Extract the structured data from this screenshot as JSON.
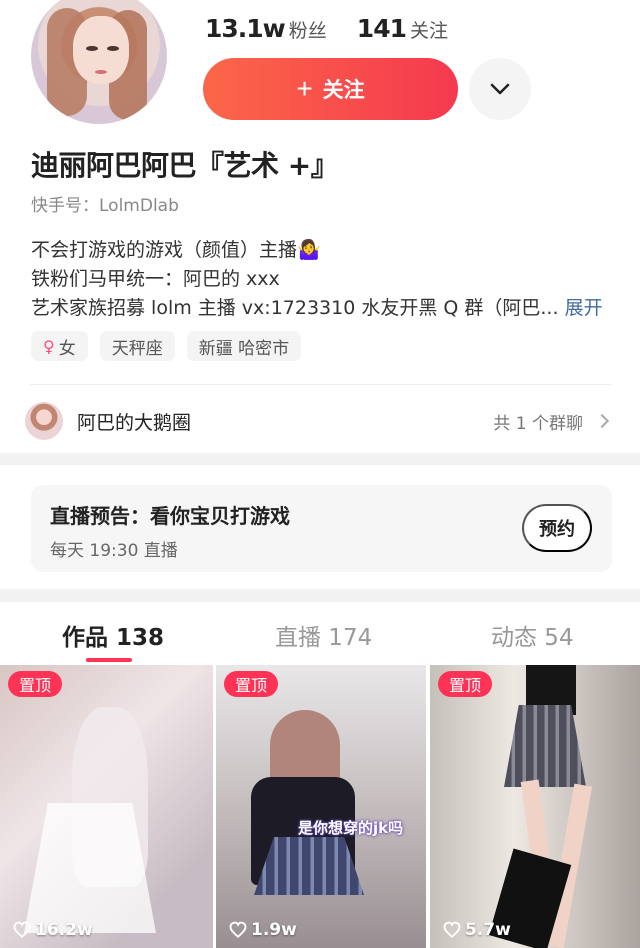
{
  "profile": {
    "followers": {
      "value": "13.1w",
      "label": "粉丝"
    },
    "following": {
      "value": "141",
      "label": "关注"
    },
    "follow_button": "关注",
    "follow_plus": "+",
    "name": "迪丽阿巴阿巴『艺术 +』",
    "kuaishou_id": "快手号：LolmDlab",
    "bio_lines": [
      "不会打游戏的游戏（颜值）主播🤷‍♀️",
      "铁粉们马甲统一：阿巴的 xxx",
      "艺术家族招募 lolm 主播 vx:1723310 水友开黑 Q 群（阿巴..."
    ],
    "expand_label": "展开",
    "tags": [
      {
        "icon": "♀",
        "label": "女"
      },
      {
        "label": "天秤座"
      },
      {
        "label": "新疆 哈密市"
      }
    ],
    "group": {
      "name": "阿巴的大鹅圈",
      "count": "共 1 个群聊"
    }
  },
  "live": {
    "title": "直播预告：看你宝贝打游戏",
    "time": "每天 19:30 直播",
    "button": "预约"
  },
  "tabs": [
    {
      "label": "作品 138",
      "active": true
    },
    {
      "label": "直播 174",
      "active": false
    },
    {
      "label": "动态 54",
      "active": false
    }
  ],
  "videos": [
    {
      "badge": "置顶",
      "likes": "16.2w"
    },
    {
      "badge": "置顶",
      "likes": "1.9w",
      "overlay_text": "是你想穿的jk吗"
    },
    {
      "badge": "置顶",
      "likes": "5.7w"
    }
  ],
  "colors": {
    "accent": "#fe3355",
    "follow_gradient_start": "#fb6748",
    "follow_gradient_end": "#f5394f",
    "expand_link": "#426aa4"
  }
}
